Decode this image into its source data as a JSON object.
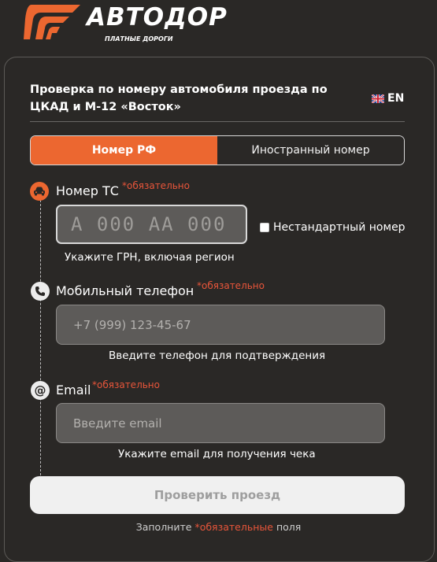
{
  "brand": {
    "name": "АВТОДОР",
    "tagline": "ПЛАТНЫЕ ДОРОГИ",
    "accent_color": "#ec6730"
  },
  "form": {
    "title": "Проверка по номеру автомобиля проезда по ЦКАД и М-12 «Восток»",
    "language": "EN",
    "tabs": [
      {
        "label": "Номер РФ",
        "active": true
      },
      {
        "label": "Иностранный номер",
        "active": false
      }
    ],
    "required_mark": "*обязательно",
    "vehicle": {
      "label": "Номер ТС",
      "icon": "car-icon",
      "plate_placeholder": "A 000 AA 000",
      "nonstandard_label": "Нестандартный номер",
      "nonstandard_checked": false,
      "hint": "Укажите ГРН, включая регион"
    },
    "phone": {
      "label": "Мобильный телефон",
      "icon": "phone-icon",
      "placeholder": "+7 (999) 123-45-67",
      "hint": "Введите телефон для подтверждения"
    },
    "email": {
      "label": "Email",
      "icon": "at-icon",
      "placeholder": "Введите email",
      "hint": "Укажите email для получения чека"
    },
    "submit_label": "Проверить проезд",
    "footnote": {
      "before": "Заполните",
      "required": "*обязательные",
      "after": "поля"
    }
  }
}
